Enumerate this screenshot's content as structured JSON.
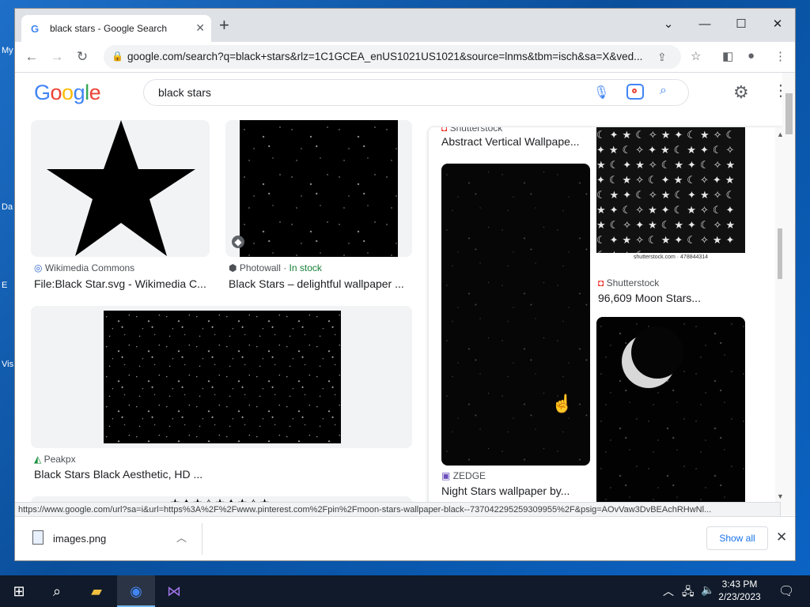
{
  "desktop": {
    "icon_labels": [
      "My",
      "Da",
      "E",
      "Vis"
    ]
  },
  "browser": {
    "tab": {
      "title": "black stars - Google Search",
      "favicon": "G"
    },
    "new_tab": "+",
    "address_bar": {
      "url": "google.com/search?q=black+stars&rlz=1C1GCEA_enUS1021US1021&source=lnms&tbm=isch&sa=X&ved..."
    },
    "status_url": "https://www.google.com/url?sa=i&url=https%3A%2F%2Fwww.pinterest.com%2Fpin%2Fmoon-stars-wallpaper-black--737042295259309955%2F&psig=AOvVaw3DvBEAchRHwNl...",
    "downloads": {
      "file": "images.png",
      "show_all": "Show all"
    }
  },
  "google": {
    "logo": [
      "G",
      "o",
      "o",
      "g",
      "l",
      "e"
    ],
    "logo_colors": [
      "#4285f4",
      "#ea4335",
      "#fbbc05",
      "#4285f4",
      "#34a853",
      "#ea4335"
    ],
    "query": "black stars"
  },
  "results": [
    {
      "source": "Wikimedia Commons",
      "title": "File:Black Star.svg - Wikimedia C..."
    },
    {
      "source": "Photowall",
      "stock": "In stock",
      "title": "Black Stars – delightful wallpaper ..."
    },
    {
      "source": "Peakpx",
      "title": "Black Stars Black Aesthetic, HD ..."
    }
  ],
  "panel": {
    "top_source": "Shutterstock",
    "top_title": "Abstract Vertical Wallpape...",
    "items": [
      {
        "source": "Shutterstock",
        "title": "96,609 Moon Stars...",
        "watermark": "shutterstock.com · 478844314"
      },
      {
        "source": "ZEDGE",
        "title": "Night Stars wallpaper by..."
      }
    ]
  },
  "taskbar": {
    "time": "3:43 PM",
    "date": "2/23/2023"
  }
}
